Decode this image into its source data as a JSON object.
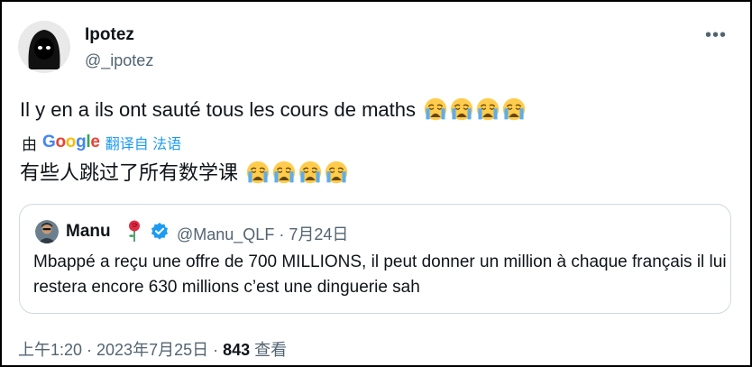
{
  "tweet": {
    "display_name": "Ipotez",
    "handle": "@_ipotez",
    "text": "Il y en a ils ont sauté tous les cours de maths",
    "translate": {
      "by_label": "由",
      "google_letters": [
        {
          "ch": "G",
          "color": "#4285F4"
        },
        {
          "ch": "o",
          "color": "#EA4335"
        },
        {
          "ch": "o",
          "color": "#FBBC05"
        },
        {
          "ch": "g",
          "color": "#4285F4"
        },
        {
          "ch": "l",
          "color": "#34A853"
        },
        {
          "ch": "e",
          "color": "#EA4335"
        }
      ],
      "link_label": "翻译自 法语",
      "translated_text": "有些人跳过了所有数学课"
    },
    "emoji_icon": "loudly-crying-face-icon",
    "emoji_count": 4
  },
  "quote": {
    "name": "Manu",
    "handle_date": "@Manu_QLF · 7月24日",
    "text": "Mbappé a reçu une offre de 700 MILLIONS, il peut donner un million à chaque français il lui restera encore 630 millions c’est une dinguerie sah"
  },
  "footer": {
    "time_date": "上午1:20 · 2023年7月25日 · ",
    "views_count": "843",
    "views_label": " 查看"
  },
  "colors": {
    "text": "#0f1419",
    "secondary": "#536471",
    "accent": "#1d9bf0",
    "border": "#cfd9de"
  }
}
